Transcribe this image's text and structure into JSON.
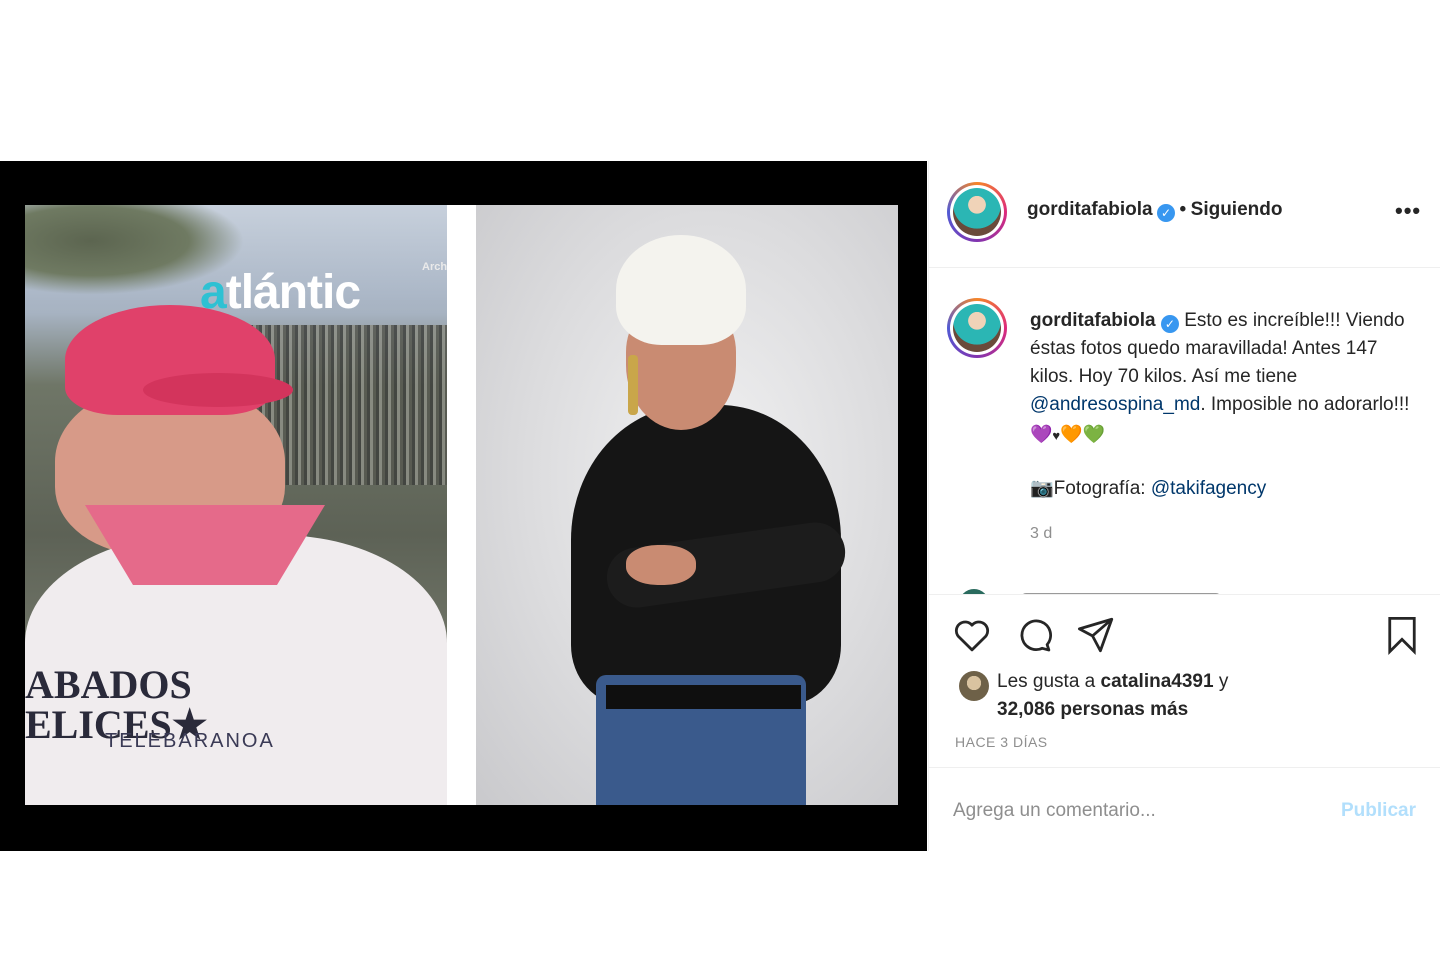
{
  "post": {
    "username": "gorditafabiola",
    "follow_separator": "•",
    "follow_status": "Siguiendo",
    "more_icon": "more-horizontal-icon",
    "media": {
      "before_watermark_brand_a": "a",
      "before_watermark_brand_rest": "tlántic",
      "before_watermark_tag": "Arch",
      "before_shirt_text_line1": "ABADOS",
      "before_shirt_text_line2": "ELICES★",
      "before_shirt_sub": "TELEBARANOA"
    },
    "caption": {
      "username": "gorditafabiola",
      "line1": "Esto es increíble!!! Viendo éstas fotos quedo maravillada! Antes 147 kilos. Hoy 70 kilos. Así me tiene ",
      "mention1": "@andresospina_md",
      "line2": ". Imposible no adorarlo!!!",
      "hearts": [
        "💜",
        "♥",
        "🧡",
        "💚"
      ],
      "camera_emoji": "📷",
      "photo_label": "Fotografía: ",
      "mention2": "@takifagency",
      "time": "3 d"
    },
    "actions": {
      "like_icon": "heart-icon",
      "comment_icon": "comment-icon",
      "share_icon": "send-icon",
      "save_icon": "bookmark-icon"
    },
    "likes": {
      "prefix": "Les gusta a ",
      "first_user": "catalina4391",
      "joiner": " y",
      "count_text": "32,086 personas más"
    },
    "date": "HACE 3 DÍAS",
    "comment_box": {
      "placeholder": "Agrega un comentario...",
      "publish_label": "Publicar"
    },
    "colors": {
      "verified": "#3897f0",
      "mention": "#00376b",
      "publish_disabled": "#b2dffc",
      "secondary_text": "#8e8e8e"
    }
  }
}
